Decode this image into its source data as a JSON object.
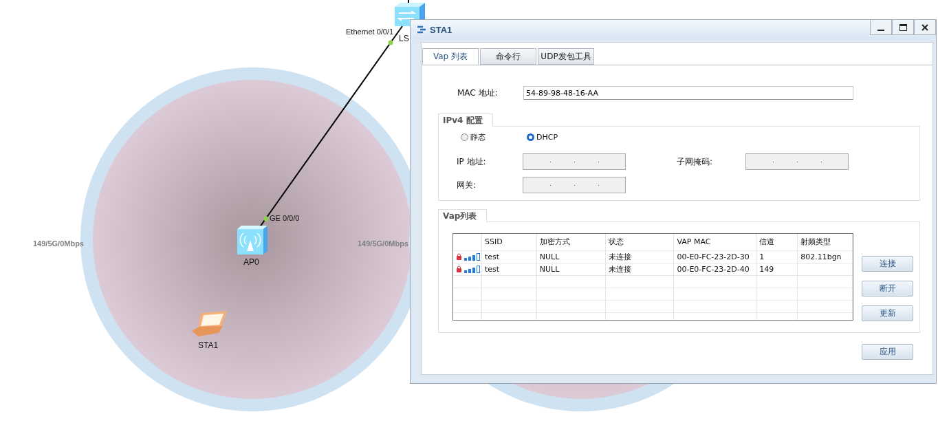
{
  "topology": {
    "nodes": [
      {
        "kind": "switch",
        "label": "LS"
      },
      {
        "kind": "ap",
        "label": "AP0"
      },
      {
        "kind": "laptop",
        "label": "STA1"
      }
    ],
    "ports": [
      {
        "label": "Ethernet 0/0/1"
      },
      {
        "label": "GE 0/0/0"
      }
    ],
    "coverage_labels": [
      "149/5G/0Mbps",
      "149/5G/0Mbps"
    ]
  },
  "window": {
    "title": "STA1"
  },
  "tabs": [
    {
      "label": "Vap 列表",
      "selected": true
    },
    {
      "label": "命令行",
      "selected": false
    },
    {
      "label": "UDP发包工具",
      "selected": false
    }
  ],
  "mac": {
    "label": "MAC 地址:",
    "value": "54-89-98-48-16-AA"
  },
  "ipv4": {
    "title": "IPv4 配置",
    "modes": [
      {
        "label": "静态",
        "selected": false
      },
      {
        "label": "DHCP",
        "selected": true
      }
    ],
    "fields": [
      {
        "label": "IP 地址:"
      },
      {
        "label": "子网掩码:"
      },
      {
        "label": "网关:"
      }
    ]
  },
  "vap": {
    "title": "Vap列表",
    "columns": [
      "SSID",
      "加密方式",
      "状态",
      "VAP MAC",
      "信道",
      "射频类型"
    ],
    "rows": [
      {
        "cells": [
          "test",
          "NULL",
          "未连接",
          "00-E0-FC-23-2D-30",
          "1",
          "802.11bgn"
        ]
      },
      {
        "cells": [
          "test",
          "NULL",
          "未连接",
          "00-E0-FC-23-2D-40",
          "149",
          ""
        ]
      }
    ],
    "buttons": [
      "连接",
      "断开",
      "更新"
    ]
  },
  "apply": "应用"
}
